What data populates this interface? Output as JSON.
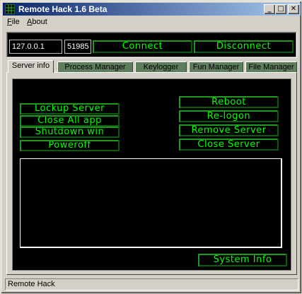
{
  "window": {
    "title": "Remote Hack 1.6 Beta",
    "controls": {
      "minimize": "_",
      "maximize": "□",
      "close": "✕"
    }
  },
  "menu": {
    "items": [
      {
        "accel": "F",
        "rest": "ile"
      },
      {
        "accel": "A",
        "rest": "bout"
      }
    ]
  },
  "connection": {
    "ip_value": "127.0.0.1",
    "port_value": "51985",
    "connect_label": "Connect",
    "disconnect_label": "Disconnect"
  },
  "tabs": [
    {
      "label": "Server info",
      "active": true
    },
    {
      "label": "Process Manager",
      "active": false
    },
    {
      "label": "Keylogger",
      "active": false
    },
    {
      "label": "Fun Manager",
      "active": false
    },
    {
      "label": "File Manager",
      "active": false
    }
  ],
  "server_info": {
    "left_buttons": [
      "Lockup Server",
      "Close All app",
      "Shutdown win",
      "Poweroff"
    ],
    "right_buttons": [
      "Reboot",
      "Re-logon",
      "Remove Server",
      "Close Server"
    ],
    "log_text": "",
    "system_info_label": "System Info"
  },
  "status": {
    "text": "Remote Hack"
  },
  "colors": {
    "accent_green": "#00ff00",
    "titlebar": "#0a246a",
    "panel_bg": "#000000"
  }
}
